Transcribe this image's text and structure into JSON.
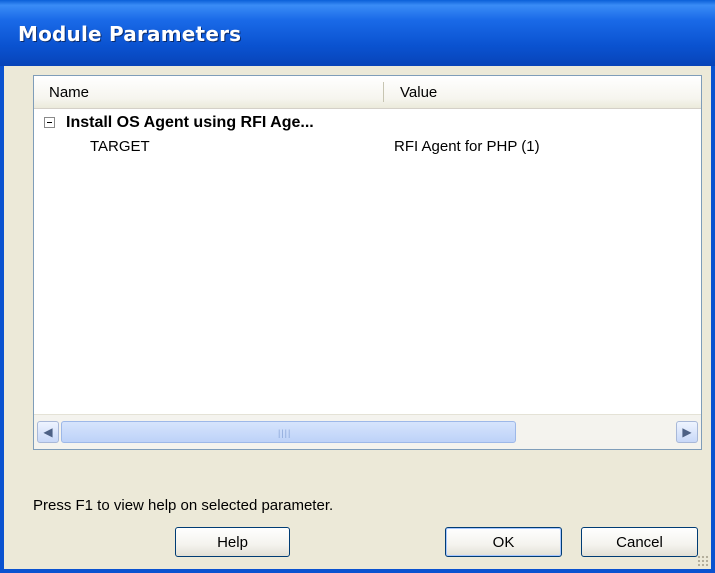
{
  "window": {
    "title": "Module Parameters"
  },
  "list": {
    "columns": [
      "Name",
      "Value"
    ],
    "group": {
      "label": "Install OS Agent using RFI Age...",
      "expanded": true
    },
    "rows": [
      {
        "name": "TARGET",
        "value": "RFI Agent for PHP (1)"
      }
    ]
  },
  "status_text": "Press F1 to view help on selected parameter.",
  "buttons": {
    "help": "Help",
    "ok": "OK",
    "cancel": "Cancel"
  },
  "icons": {
    "expander": "minus-box-icon",
    "scroll_left": "arrow-left-icon",
    "scroll_right": "arrow-right-icon"
  },
  "colors": {
    "titlebar": "#0a52d0",
    "dialog_bg": "#ece9d8",
    "accent": "#003c74"
  }
}
